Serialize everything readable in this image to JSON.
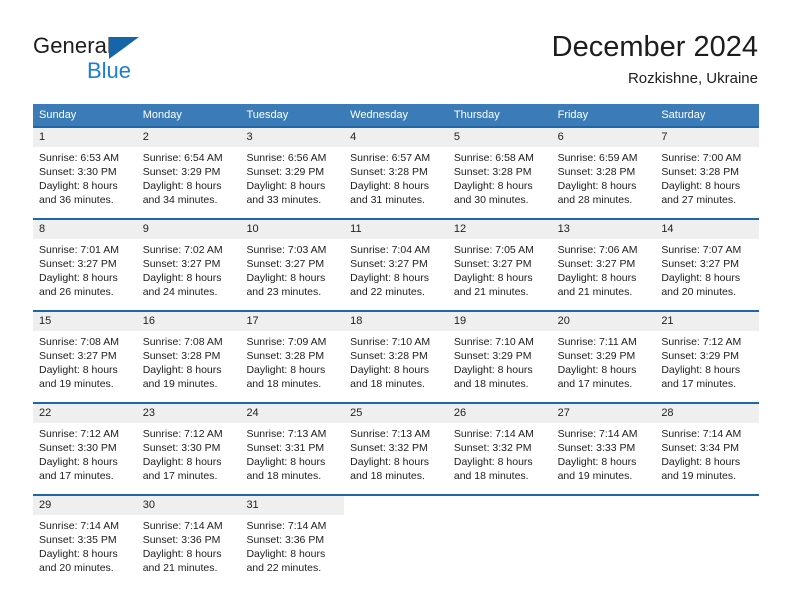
{
  "brand": {
    "name_part1": "General",
    "name_part2": "Blue",
    "accent_blue": "#1b7fd4",
    "logo_triangle_color": "#1565a8"
  },
  "header": {
    "title": "December 2024",
    "subtitle": "Rozkishne, Ukraine"
  },
  "theme": {
    "header_row_bg": "#3b7cb8",
    "week_separator": "#1f66ab",
    "day_number_bg": "#efefef",
    "text": "#1d1d1d"
  },
  "weekdays": [
    "Sunday",
    "Monday",
    "Tuesday",
    "Wednesday",
    "Thursday",
    "Friday",
    "Saturday"
  ],
  "weeks": [
    {
      "numbers": [
        "1",
        "2",
        "3",
        "4",
        "5",
        "6",
        "7"
      ],
      "days": [
        {
          "sunrise": "Sunrise: 6:53 AM",
          "sunset": "Sunset: 3:30 PM",
          "daylight1": "Daylight: 8 hours",
          "daylight2": "and 36 minutes."
        },
        {
          "sunrise": "Sunrise: 6:54 AM",
          "sunset": "Sunset: 3:29 PM",
          "daylight1": "Daylight: 8 hours",
          "daylight2": "and 34 minutes."
        },
        {
          "sunrise": "Sunrise: 6:56 AM",
          "sunset": "Sunset: 3:29 PM",
          "daylight1": "Daylight: 8 hours",
          "daylight2": "and 33 minutes."
        },
        {
          "sunrise": "Sunrise: 6:57 AM",
          "sunset": "Sunset: 3:28 PM",
          "daylight1": "Daylight: 8 hours",
          "daylight2": "and 31 minutes."
        },
        {
          "sunrise": "Sunrise: 6:58 AM",
          "sunset": "Sunset: 3:28 PM",
          "daylight1": "Daylight: 8 hours",
          "daylight2": "and 30 minutes."
        },
        {
          "sunrise": "Sunrise: 6:59 AM",
          "sunset": "Sunset: 3:28 PM",
          "daylight1": "Daylight: 8 hours",
          "daylight2": "and 28 minutes."
        },
        {
          "sunrise": "Sunrise: 7:00 AM",
          "sunset": "Sunset: 3:28 PM",
          "daylight1": "Daylight: 8 hours",
          "daylight2": "and 27 minutes."
        }
      ]
    },
    {
      "numbers": [
        "8",
        "9",
        "10",
        "11",
        "12",
        "13",
        "14"
      ],
      "days": [
        {
          "sunrise": "Sunrise: 7:01 AM",
          "sunset": "Sunset: 3:27 PM",
          "daylight1": "Daylight: 8 hours",
          "daylight2": "and 26 minutes."
        },
        {
          "sunrise": "Sunrise: 7:02 AM",
          "sunset": "Sunset: 3:27 PM",
          "daylight1": "Daylight: 8 hours",
          "daylight2": "and 24 minutes."
        },
        {
          "sunrise": "Sunrise: 7:03 AM",
          "sunset": "Sunset: 3:27 PM",
          "daylight1": "Daylight: 8 hours",
          "daylight2": "and 23 minutes."
        },
        {
          "sunrise": "Sunrise: 7:04 AM",
          "sunset": "Sunset: 3:27 PM",
          "daylight1": "Daylight: 8 hours",
          "daylight2": "and 22 minutes."
        },
        {
          "sunrise": "Sunrise: 7:05 AM",
          "sunset": "Sunset: 3:27 PM",
          "daylight1": "Daylight: 8 hours",
          "daylight2": "and 21 minutes."
        },
        {
          "sunrise": "Sunrise: 7:06 AM",
          "sunset": "Sunset: 3:27 PM",
          "daylight1": "Daylight: 8 hours",
          "daylight2": "and 21 minutes."
        },
        {
          "sunrise": "Sunrise: 7:07 AM",
          "sunset": "Sunset: 3:27 PM",
          "daylight1": "Daylight: 8 hours",
          "daylight2": "and 20 minutes."
        }
      ]
    },
    {
      "numbers": [
        "15",
        "16",
        "17",
        "18",
        "19",
        "20",
        "21"
      ],
      "days": [
        {
          "sunrise": "Sunrise: 7:08 AM",
          "sunset": "Sunset: 3:27 PM",
          "daylight1": "Daylight: 8 hours",
          "daylight2": "and 19 minutes."
        },
        {
          "sunrise": "Sunrise: 7:08 AM",
          "sunset": "Sunset: 3:28 PM",
          "daylight1": "Daylight: 8 hours",
          "daylight2": "and 19 minutes."
        },
        {
          "sunrise": "Sunrise: 7:09 AM",
          "sunset": "Sunset: 3:28 PM",
          "daylight1": "Daylight: 8 hours",
          "daylight2": "and 18 minutes."
        },
        {
          "sunrise": "Sunrise: 7:10 AM",
          "sunset": "Sunset: 3:28 PM",
          "daylight1": "Daylight: 8 hours",
          "daylight2": "and 18 minutes."
        },
        {
          "sunrise": "Sunrise: 7:10 AM",
          "sunset": "Sunset: 3:29 PM",
          "daylight1": "Daylight: 8 hours",
          "daylight2": "and 18 minutes."
        },
        {
          "sunrise": "Sunrise: 7:11 AM",
          "sunset": "Sunset: 3:29 PM",
          "daylight1": "Daylight: 8 hours",
          "daylight2": "and 17 minutes."
        },
        {
          "sunrise": "Sunrise: 7:12 AM",
          "sunset": "Sunset: 3:29 PM",
          "daylight1": "Daylight: 8 hours",
          "daylight2": "and 17 minutes."
        }
      ]
    },
    {
      "numbers": [
        "22",
        "23",
        "24",
        "25",
        "26",
        "27",
        "28"
      ],
      "days": [
        {
          "sunrise": "Sunrise: 7:12 AM",
          "sunset": "Sunset: 3:30 PM",
          "daylight1": "Daylight: 8 hours",
          "daylight2": "and 17 minutes."
        },
        {
          "sunrise": "Sunrise: 7:12 AM",
          "sunset": "Sunset: 3:30 PM",
          "daylight1": "Daylight: 8 hours",
          "daylight2": "and 17 minutes."
        },
        {
          "sunrise": "Sunrise: 7:13 AM",
          "sunset": "Sunset: 3:31 PM",
          "daylight1": "Daylight: 8 hours",
          "daylight2": "and 18 minutes."
        },
        {
          "sunrise": "Sunrise: 7:13 AM",
          "sunset": "Sunset: 3:32 PM",
          "daylight1": "Daylight: 8 hours",
          "daylight2": "and 18 minutes."
        },
        {
          "sunrise": "Sunrise: 7:14 AM",
          "sunset": "Sunset: 3:32 PM",
          "daylight1": "Daylight: 8 hours",
          "daylight2": "and 18 minutes."
        },
        {
          "sunrise": "Sunrise: 7:14 AM",
          "sunset": "Sunset: 3:33 PM",
          "daylight1": "Daylight: 8 hours",
          "daylight2": "and 19 minutes."
        },
        {
          "sunrise": "Sunrise: 7:14 AM",
          "sunset": "Sunset: 3:34 PM",
          "daylight1": "Daylight: 8 hours",
          "daylight2": "and 19 minutes."
        }
      ]
    },
    {
      "numbers": [
        "29",
        "30",
        "31",
        "",
        "",
        "",
        ""
      ],
      "days": [
        {
          "sunrise": "Sunrise: 7:14 AM",
          "sunset": "Sunset: 3:35 PM",
          "daylight1": "Daylight: 8 hours",
          "daylight2": "and 20 minutes."
        },
        {
          "sunrise": "Sunrise: 7:14 AM",
          "sunset": "Sunset: 3:36 PM",
          "daylight1": "Daylight: 8 hours",
          "daylight2": "and 21 minutes."
        },
        {
          "sunrise": "Sunrise: 7:14 AM",
          "sunset": "Sunset: 3:36 PM",
          "daylight1": "Daylight: 8 hours",
          "daylight2": "and 22 minutes."
        },
        {
          "sunrise": "",
          "sunset": "",
          "daylight1": "",
          "daylight2": ""
        },
        {
          "sunrise": "",
          "sunset": "",
          "daylight1": "",
          "daylight2": ""
        },
        {
          "sunrise": "",
          "sunset": "",
          "daylight1": "",
          "daylight2": ""
        },
        {
          "sunrise": "",
          "sunset": "",
          "daylight1": "",
          "daylight2": ""
        }
      ]
    }
  ]
}
